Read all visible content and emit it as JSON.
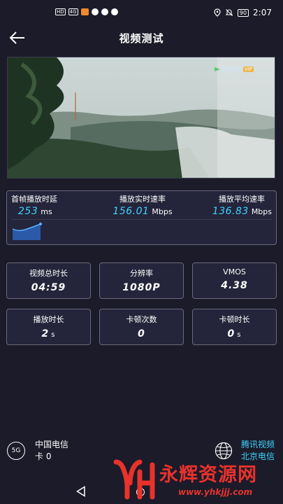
{
  "status_bar": {
    "left_chips": [
      "HD",
      "4G"
    ],
    "time": "2:07",
    "battery": "90"
  },
  "header": {
    "title": "视频测试"
  },
  "video": {
    "watermark": "腾讯视频",
    "watermark_badge": "VIP"
  },
  "speed_panel": {
    "first_frame": {
      "label": "首帧播放时延",
      "value": "253",
      "unit": "ms"
    },
    "realtime_rate": {
      "label": "播放实时速率",
      "value": "156.01",
      "unit": "Mbps"
    },
    "average_rate": {
      "label": "播放平均速率",
      "value": "136.83",
      "unit": "Mbps"
    }
  },
  "cards": {
    "total_duration": {
      "label": "视频总时长",
      "value": "04:59"
    },
    "resolution": {
      "label": "分辨率",
      "value": "1080P"
    },
    "vmos": {
      "label": "VMOS",
      "value": "4.38"
    },
    "play_duration": {
      "label": "播放时长",
      "value": "2",
      "unit": "s"
    },
    "stall_count": {
      "label": "卡顿次数",
      "value": "0"
    },
    "stall_duration": {
      "label": "卡顿时长",
      "value": "0",
      "unit": "s"
    }
  },
  "footer": {
    "network_badge": "5G",
    "carrier": "中国电信",
    "sim": "卡 0",
    "service": "腾讯视频",
    "location_carrier": "北京电信"
  },
  "watermark": {
    "title": "永辉资源网",
    "url": "www.yhkjjj.com"
  },
  "colors": {
    "background": "#1b1b29",
    "accent_cyan": "#3fd4ff",
    "panel_border": "#6a6a7c",
    "watermark_red": "#e8322c"
  },
  "icons": {
    "back": "arrow-left-icon",
    "globe": "globe-icon",
    "nav_back": "triangle-back-icon",
    "nav_home": "circle-home-icon"
  }
}
